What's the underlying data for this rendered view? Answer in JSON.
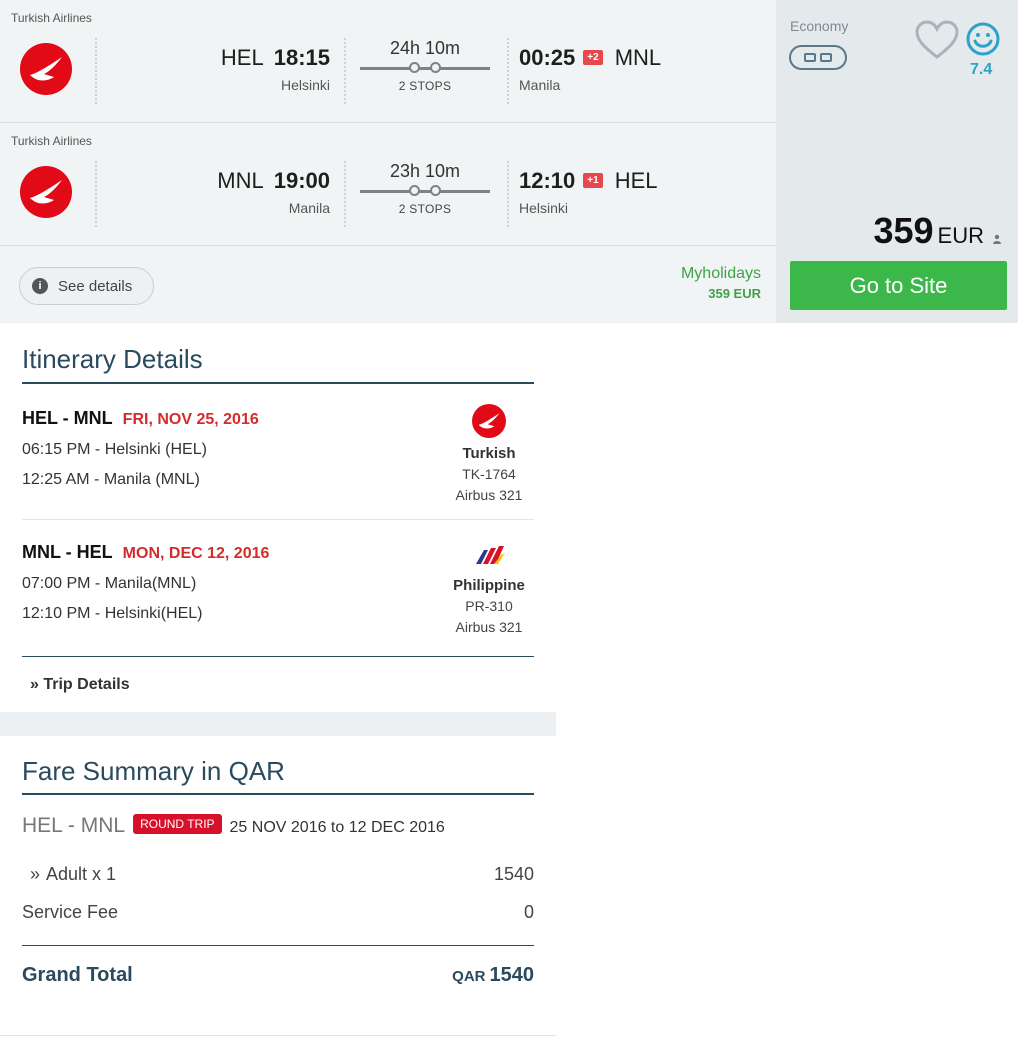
{
  "result": {
    "legs": [
      {
        "airline": "Turkish Airlines",
        "dep_code": "HEL",
        "dep_time": "18:15",
        "dep_city": "Helsinki",
        "duration": "24h 10m",
        "stops": "2 STOPS",
        "arr_time": "00:25",
        "day_offset": "+2",
        "arr_code": "MNL",
        "arr_city": "Manila"
      },
      {
        "airline": "Turkish Airlines",
        "dep_code": "MNL",
        "dep_time": "19:00",
        "dep_city": "Manila",
        "duration": "23h 10m",
        "stops": "2 STOPS",
        "arr_time": "12:10",
        "day_offset": "+1",
        "arr_code": "HEL",
        "arr_city": "Helsinki"
      }
    ],
    "see_details": "See details",
    "provider_name": "Myholidays",
    "provider_price": "359 EUR",
    "cabin": "Economy",
    "rating": "7.4",
    "price": "359",
    "currency": "EUR",
    "cta": "Go to Site"
  },
  "itinerary": {
    "title": "Itinerary Details",
    "segments": [
      {
        "route": "HEL - MNL",
        "date": "FRI, NOV 25, 2016",
        "dep": "06:15 PM - Helsinki (HEL)",
        "arr": "12:25 AM - Manila (MNL)",
        "carrier": "Turkish",
        "flight": "TK-1764",
        "aircraft": "Airbus 321"
      },
      {
        "route": "MNL - HEL",
        "date": "MON, DEC 12, 2016",
        "dep": "07:00 PM - Manila(MNL)",
        "arr": "12:10 PM - Helsinki(HEL)",
        "carrier": "Philippine",
        "flight": "PR-310",
        "aircraft": "Airbus 321"
      }
    ],
    "trip_details": "Trip Details"
  },
  "fare": {
    "title": "Fare Summary in QAR",
    "route": "HEL - MNL",
    "trip_type": "ROUND TRIP",
    "dates": "25 NOV 2016 to 12 DEC 2016",
    "adult_label": "Adult x 1",
    "adult_value": "1540",
    "fee_label": "Service Fee",
    "fee_value": "0",
    "total_label": "Grand Total",
    "total_currency": "QAR",
    "total_value": "1540"
  },
  "colors": {
    "accent_green": "#3cb84a",
    "date_red": "#d52b2b",
    "turkish_red": "#e30a17",
    "heading_navy": "#2a4a5e",
    "rating_blue": "#2ba3c9"
  }
}
